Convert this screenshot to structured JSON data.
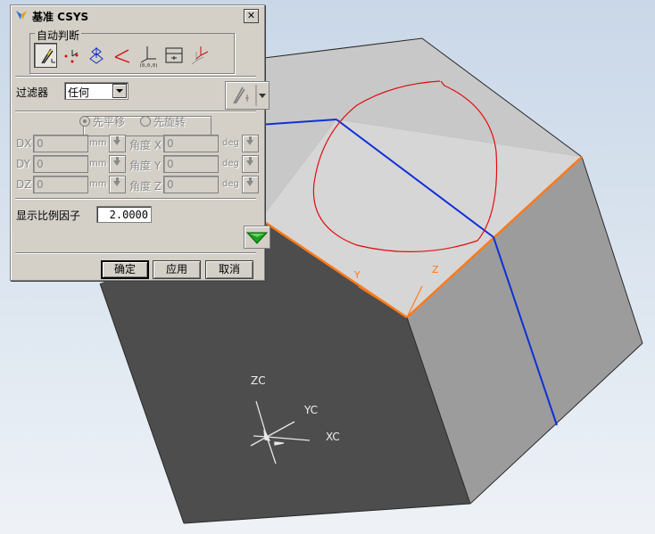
{
  "dialog": {
    "title": "基准 CSYS",
    "close_glyph": "✕",
    "inference_group_label": "自动判断",
    "inference_tools": [
      "inferred-icon",
      "origin-x-y-icon",
      "three-planes-icon",
      "two-lines-icon",
      "absolute-csys-icon",
      "current-view-icon",
      "offset-csys-icon"
    ],
    "filter_label": "过滤器",
    "filter_value": "任何",
    "radio_translate": "先平移",
    "radio_rotate": "先旋转",
    "offsets": [
      {
        "axis": "DX",
        "value": "0",
        "unit": "mm",
        "angle_label": "角度 X",
        "angle_value": "0",
        "angle_unit": "deg"
      },
      {
        "axis": "DY",
        "value": "0",
        "unit": "mm",
        "angle_label": "角度 Y",
        "angle_value": "0",
        "angle_unit": "deg"
      },
      {
        "axis": "DZ",
        "value": "0",
        "unit": "mm",
        "angle_label": "角度 Z",
        "angle_value": "0",
        "angle_unit": "deg"
      }
    ],
    "scale_label": "显示比例因子",
    "scale_value": "2.0000",
    "ok_label": "确定",
    "apply_label": "应用",
    "cancel_label": "取消"
  },
  "viewport": {
    "top_face_axis_labels": {
      "y": "Y",
      "z": "Z"
    },
    "view_triad": {
      "z": "ZC",
      "y": "YC",
      "x": "XC"
    }
  },
  "colors": {
    "face_top": "#d6d6d6",
    "face_left": "#4d4d4d",
    "face_right": "#9c9c9c",
    "face_back": "#7e7e7e",
    "edge_highlight": "#ff7a1a",
    "sketch_curve": "#e01010",
    "blue_line": "#1030d8",
    "dialog_bg": "#d4d0c8",
    "ok_arrow": "#1aa01a"
  }
}
